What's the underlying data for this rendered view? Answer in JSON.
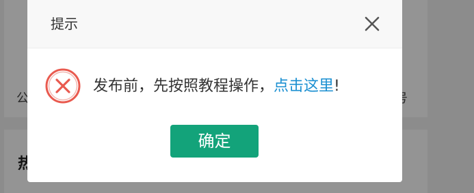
{
  "background": {
    "left_text": "公",
    "right_text": "号",
    "bold_text": "热"
  },
  "dialog": {
    "title": "提示",
    "close_icon": "close-icon",
    "error_icon": "error-circle-x-icon",
    "message_prefix": "发布前，先按照教程操作，",
    "message_link": "点击这里",
    "message_suffix": "!",
    "confirm_label": "确定",
    "colors": {
      "accent_button": "#13a37a",
      "link": "#1a8fd1",
      "error_icon": "#e95a4f"
    }
  }
}
